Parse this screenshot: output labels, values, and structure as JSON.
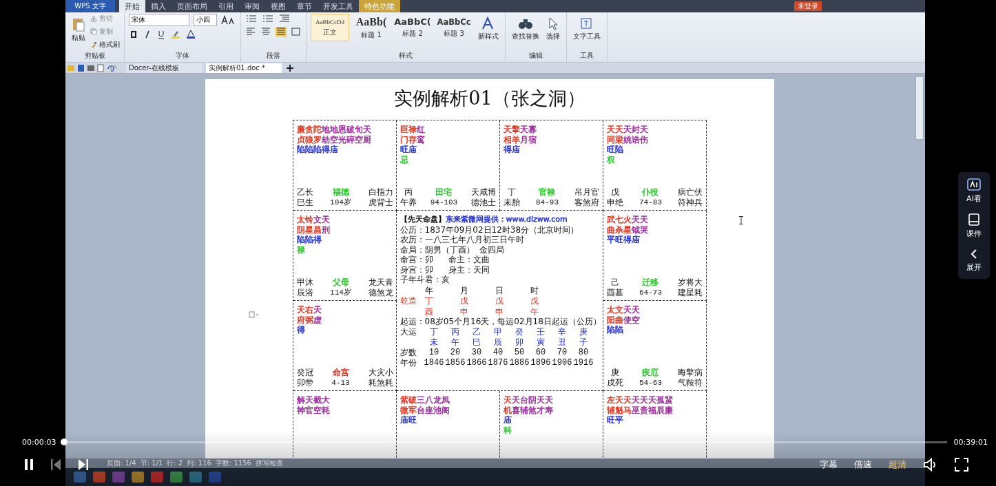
{
  "app": {
    "menu_button": "WPS 文字",
    "tabs": [
      {
        "label": "开始",
        "selected": true,
        "kind": "normal"
      },
      {
        "label": "插入",
        "selected": false,
        "kind": "normal"
      },
      {
        "label": "页面布局",
        "selected": false,
        "kind": "normal"
      },
      {
        "label": "引用",
        "selected": false,
        "kind": "normal"
      },
      {
        "label": "审阅",
        "selected": false,
        "kind": "normal"
      },
      {
        "label": "视图",
        "selected": false,
        "kind": "normal"
      },
      {
        "label": "章节",
        "selected": false,
        "kind": "normal"
      },
      {
        "label": "开发工具",
        "selected": false,
        "kind": "normal"
      },
      {
        "label": "特色功能",
        "selected": false,
        "kind": "special"
      }
    ],
    "login": "未登录",
    "ribbon": {
      "clipboard": {
        "paste": "粘贴",
        "cut": "剪切",
        "copy": "复制",
        "painter": "格式刷",
        "label": "剪贴板"
      },
      "font": {
        "family": "宋体",
        "size": "小四",
        "label": "字体"
      },
      "paragraph": {
        "label": "段落"
      },
      "styles": {
        "items": [
          {
            "sample": "AaBbCcDd",
            "name": "正文",
            "kind": "body",
            "selected": true
          },
          {
            "sample": "AaBb(",
            "name": "标题 1",
            "kind": "h1",
            "selected": false
          },
          {
            "sample": "AaBbC(",
            "name": "标题 2",
            "kind": "h2",
            "selected": false
          },
          {
            "sample": "AaBbCc",
            "name": "标题 3",
            "kind": "h3",
            "selected": false
          }
        ],
        "new_style": "新样式",
        "label": "样式"
      },
      "edit": {
        "find": "查找替换",
        "select": "选择",
        "label": "编辑"
      },
      "tools": {
        "text_tools": "文字工具",
        "label": "工具"
      }
    },
    "doc_tabs": [
      {
        "label": "Docer-在线模板",
        "selected": false
      },
      {
        "label": "实例解析01.doc *",
        "selected": true
      }
    ]
  },
  "document": {
    "title": "实例解析01（张之洞）",
    "cells": [
      {
        "lines": [
          [
            {
              "t": "廉贪陀",
              "color": "#e0301c"
            },
            {
              "t": "地地恩破旬天",
              "color": "#98289a"
            }
          ],
          [
            {
              "t": "贞狼罗",
              "color": "#e0301c"
            },
            {
              "t": "劫空光碎空厨",
              "color": "#98289a"
            }
          ],
          [
            {
              "t": "陷陷陷得庙",
              "color": "#1c28d8"
            }
          ]
        ],
        "stem": [
          "乙长",
          "巳生"
        ],
        "palace": {
          "name": "福德",
          "color": "#22c822"
        },
        "age": "104岁",
        "gods": [
          "白指力",
          "虎背士"
        ]
      },
      {
        "lines": [
          [
            {
              "t": "巨禄",
              "color": "#e0301c"
            },
            {
              "t": "红",
              "color": "#98289a"
            }
          ],
          [
            {
              "t": "门存",
              "color": "#e0301c"
            },
            {
              "t": "鸾",
              "color": "#98289a"
            }
          ],
          [
            {
              "t": "旺庙",
              "color": "#1c28d8"
            }
          ],
          [
            {
              "t": "忌",
              "color": "#22c822"
            }
          ]
        ],
        "stem": [
          "丙",
          "午养"
        ],
        "palace": {
          "name": "田宅",
          "color": "#22c822"
        },
        "age": "94-103",
        "gods": [
          "天咸博",
          "德池士"
        ]
      },
      {
        "lines": [
          [
            {
              "t": "天擎",
              "color": "#e0301c"
            },
            {
              "t": "天寡",
              "color": "#98289a"
            }
          ],
          [
            {
              "t": "相羊",
              "color": "#e0301c"
            },
            {
              "t": "月宿",
              "color": "#98289a"
            }
          ],
          [
            {
              "t": "得庙",
              "color": "#1c28d8"
            }
          ]
        ],
        "stem": [
          "丁",
          "未胎"
        ],
        "palace": {
          "name": "官禄",
          "color": "#22c822"
        },
        "age": "84-93",
        "gods": [
          "吊月官",
          "客煞府"
        ]
      },
      {
        "lines": [
          [
            {
              "t": "天天",
              "color": "#e0301c"
            },
            {
              "t": "天封天",
              "color": "#98289a"
            }
          ],
          [
            {
              "t": "同梁",
              "color": "#e0301c"
            },
            {
              "t": "姚诰伤",
              "color": "#98289a"
            }
          ],
          [
            {
              "t": "旺陷",
              "color": "#1c28d8"
            }
          ],
          [
            {
              "t": "权",
              "color": "#22c822"
            }
          ]
        ],
        "stem": [
          "戊",
          "申绝"
        ],
        "palace": {
          "name": "仆役",
          "color": "#22c822"
        },
        "age": "74-83",
        "gods": [
          "病亡伏",
          "符神兵"
        ]
      },
      {
        "lines": [
          [
            {
              "t": "太铃",
              "color": "#e0301c"
            },
            {
              "t": "文天",
              "color": "#98289a"
            }
          ],
          [
            {
              "t": "阴星昌",
              "color": "#e0301c"
            },
            {
              "t": "刑",
              "color": "#98289a"
            }
          ],
          [
            {
              "t": "陷陷得",
              "color": "#1c28d8"
            }
          ],
          [
            {
              "t": "禄",
              "color": "#22c822"
            }
          ]
        ],
        "stem": [
          "甲沐",
          "辰浴"
        ],
        "palace": {
          "name": "父母",
          "color": "#22c822"
        },
        "age": "114岁",
        "gods": [
          "龙天青",
          "德煞龙"
        ]
      },
      {
        "lines": [
          [
            {
              "t": "武七火",
              "color": "#e0301c"
            },
            {
              "t": "天天",
              "color": "#98289a"
            }
          ],
          [
            {
              "t": "曲杀星",
              "color": "#e0301c"
            },
            {
              "t": "钺哭",
              "color": "#98289a"
            }
          ],
          [
            {
              "t": "平旺得庙",
              "color": "#1c28d8"
            }
          ]
        ],
        "stem": [
          "己",
          "酉墓"
        ],
        "palace": {
          "name": "迁移",
          "color": "#22c822"
        },
        "age": "64-73",
        "gods": [
          "岁将大",
          "建星耗"
        ]
      },
      {
        "lines": [
          [
            {
              "t": "天右",
              "color": "#e0301c"
            },
            {
              "t": "天",
              "color": "#98289a"
            }
          ],
          [
            {
              "t": "府弼",
              "color": "#e0301c"
            },
            {
              "t": "虚",
              "color": "#98289a"
            }
          ],
          [
            {
              "t": "得",
              "color": "#1c28d8"
            }
          ]
        ],
        "stem": [
          "癸冠",
          "卯带"
        ],
        "palace": {
          "name": "命宫",
          "color": "#e0301c"
        },
        "age": "4-13",
        "gods": [
          "大灾小",
          "耗煞耗"
        ]
      },
      {
        "lines": [
          [
            {
              "t": "太文",
              "color": "#e0301c"
            },
            {
              "t": "天天",
              "color": "#98289a"
            }
          ],
          [
            {
              "t": "阳曲",
              "color": "#e0301c"
            },
            {
              "t": "使空",
              "color": "#98289a"
            }
          ],
          [
            {
              "t": "陷陷",
              "color": "#1c28d8"
            }
          ]
        ],
        "stem": [
          "庚",
          "戌死"
        ],
        "palace": {
          "name": "疾厄",
          "color": "#22c822"
        },
        "age": "54-63",
        "gods": [
          "晦擎病",
          "气鞍符"
        ]
      },
      {
        "lines": [
          [
            {
              "t": "解天截大",
              "color": "#98289a"
            }
          ],
          [
            {
              "t": "神官空耗",
              "color": "#98289a"
            }
          ]
        ]
      },
      {
        "lines": [
          [
            {
              "t": "紫破",
              "color": "#e0301c"
            },
            {
              "t": "三八龙凤",
              "color": "#98289a"
            }
          ],
          [
            {
              "t": "微军",
              "color": "#e0301c"
            },
            {
              "t": "台座池阁",
              "color": "#98289a"
            }
          ],
          [
            {
              "t": "庙旺",
              "color": "#1c28d8"
            }
          ]
        ]
      },
      {
        "lines": [
          [
            {
              "t": "天",
              "color": "#e0301c"
            },
            {
              "t": "天台阴天天",
              "color": "#98289a"
            }
          ],
          [
            {
              "t": "机",
              "color": "#e0301c"
            },
            {
              "t": "喜辅煞才寿",
              "color": "#98289a"
            }
          ],
          [
            {
              "t": "庙",
              "color": "#1c28d8"
            }
          ],
          [
            {
              "t": "科",
              "color": "#22c822"
            }
          ]
        ]
      },
      {
        "lines": [
          [
            {
              "t": "左天天",
              "color": "#e0301c"
            },
            {
              "t": "天天天孤蜚",
              "color": "#98289a"
            }
          ],
          [
            {
              "t": "辅魁马",
              "color": "#e0301c"
            },
            {
              "t": "巫贵福辰廉",
              "color": "#98289a"
            }
          ],
          [
            {
              "t": "旺平",
              "color": "#1c28d8"
            }
          ]
        ]
      }
    ],
    "center": {
      "source": [
        {
          "t": "【先天命盘】",
          "color": "#111111"
        },
        {
          "t": "东来紫微网提供：www.dlzww.com",
          "color": "#1c28d8"
        }
      ],
      "info": [
        "公历：1837年09月02日12时38分（北京时间）",
        "农历：一八三七年八月初三日午时",
        "命局：阴男（丁酉）  金四局",
        "命宫：卯      命主：文曲",
        "身宫：卯      身主：天同",
        "子年斗君：亥"
      ],
      "pillar_headers": [
        "年",
        "月",
        "日",
        "时"
      ],
      "bazi_label": "乾造",
      "stems": [
        "丁",
        "戊",
        "戊",
        "戊"
      ],
      "branches": [
        "酉",
        "申",
        "申",
        "午"
      ],
      "qiyun": "起运：08岁05个月16天，每运02月18日起运（公历）",
      "dayun_label": "大运",
      "dayun_stems": [
        "丁",
        "丙",
        "乙",
        "甲",
        "癸",
        "壬",
        "辛",
        "庚"
      ],
      "dayun_branches": [
        "未",
        "午",
        "巳",
        "辰",
        "卯",
        "寅",
        "丑",
        "子"
      ],
      "age_label": "岁数",
      "ages": [
        "10",
        "20",
        "30",
        "40",
        "50",
        "60",
        "70",
        "80"
      ],
      "year_label": "年份",
      "years": [
        "1846",
        "1856",
        "1866",
        "1876",
        "1886",
        "1896",
        "1906",
        "1916"
      ]
    }
  },
  "status_bar": [
    "页面: 1/4",
    "节: 1/1",
    "行: 2",
    "列: 116",
    "字数: 1156",
    "拼写检查"
  ],
  "side_panel": [
    {
      "label": "AI看",
      "kind": "ai"
    },
    {
      "label": "课件",
      "kind": "book"
    },
    {
      "label": "展开",
      "kind": "expand"
    }
  ],
  "player": {
    "elapsed": "00:00:03",
    "duration": "00:39:01",
    "level": 0.0013,
    "subtitles": "字幕",
    "speed": "倍速",
    "quality": "超清"
  }
}
